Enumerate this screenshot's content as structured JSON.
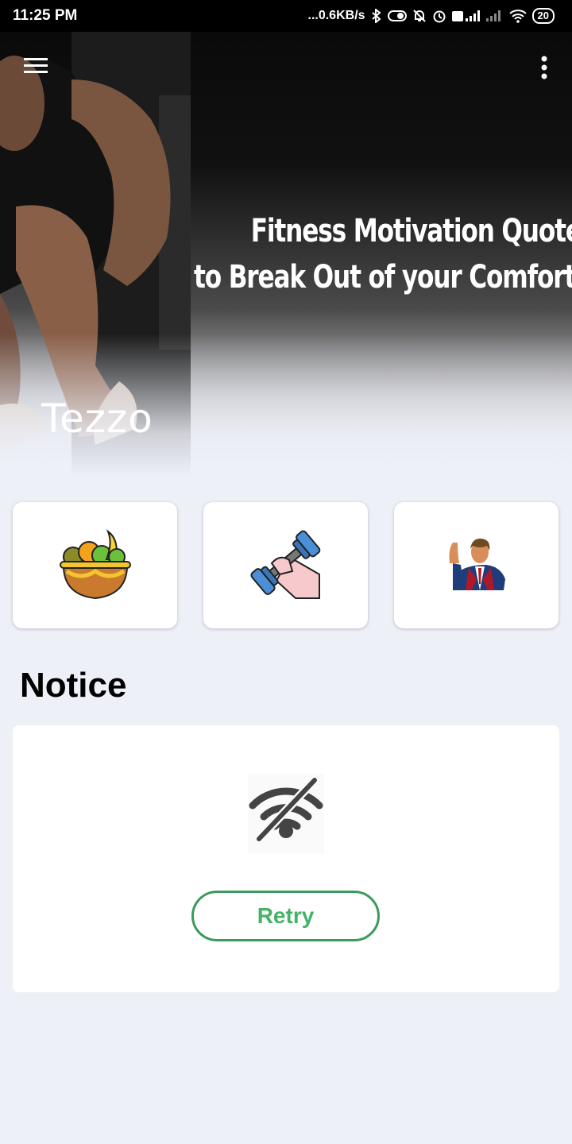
{
  "status_bar": {
    "time": "11:25 PM",
    "network_speed": "...0.6KB/s",
    "battery": "20"
  },
  "hero": {
    "quote_line1": "Fitness Motivation Quote",
    "quote_line2": "to Break Out of your Comfort",
    "name": "Tezzo"
  },
  "tiles": [
    {
      "icon": "fruit-basket-icon"
    },
    {
      "icon": "dumbbell-icon"
    },
    {
      "icon": "trainer-icon"
    }
  ],
  "notice": {
    "title": "Notice",
    "icon": "wifi-off-icon",
    "retry_label": "Retry"
  },
  "colors": {
    "page_bg": "#eef0f8",
    "retry_border": "#3a9a5a",
    "retry_text": "#45b268"
  }
}
